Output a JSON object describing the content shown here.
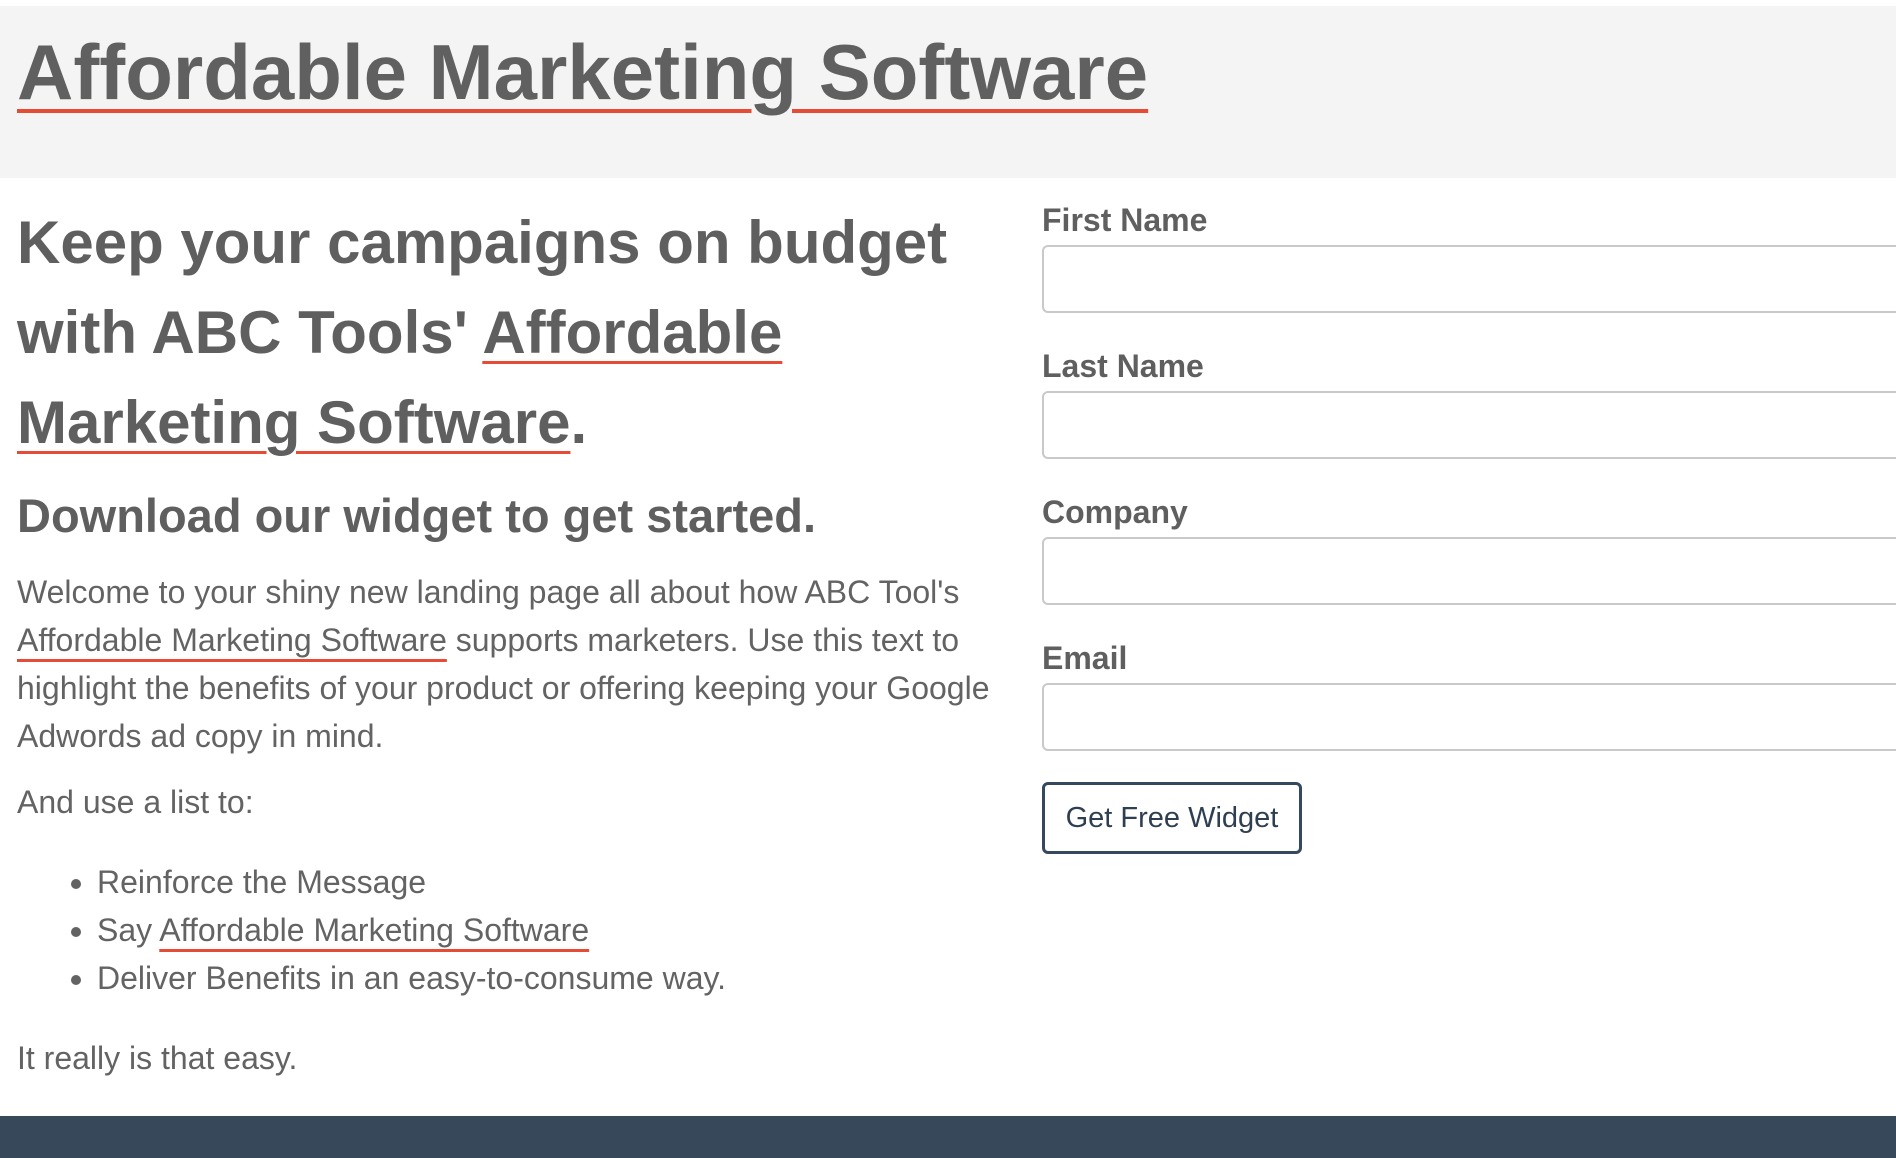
{
  "header": {
    "title": "Affordable Marketing Software"
  },
  "hero": {
    "headline_part1": "Keep your campaigns on budget with ABC Tools' ",
    "headline_keyword": "Affordable Marketing Software",
    "headline_end": ".",
    "subheadline": "Download our widget to get started."
  },
  "content": {
    "intro_part1": "Welcome to your shiny new landing page all about how ABC Tool's ",
    "intro_keyword": "Affordable Marketing Software",
    "intro_part2": " supports marketers. Use this text to highlight the benefits of your product or offering keeping your Google Adwords ad copy in mind.",
    "list_intro": "And use a list to:",
    "bullets": {
      "item1": "Reinforce the Message",
      "item2_prefix": "Say ",
      "item2_keyword": "Affordable Marketing Software",
      "item3": "Deliver Benefits in an easy-to-consume way."
    },
    "closing": "It really is that easy."
  },
  "form": {
    "first_name_label": "First Name",
    "first_name_value": "",
    "last_name_label": "Last Name",
    "last_name_value": "",
    "company_label": "Company",
    "company_value": "",
    "email_label": "Email",
    "email_value": "",
    "submit_label": "Get Free Widget"
  },
  "colors": {
    "keyword_underline": "#e54b35",
    "header_background": "#f4f4f4",
    "footer_background": "#36485a",
    "button_border": "#34495e",
    "text": "#5f5f5f"
  }
}
